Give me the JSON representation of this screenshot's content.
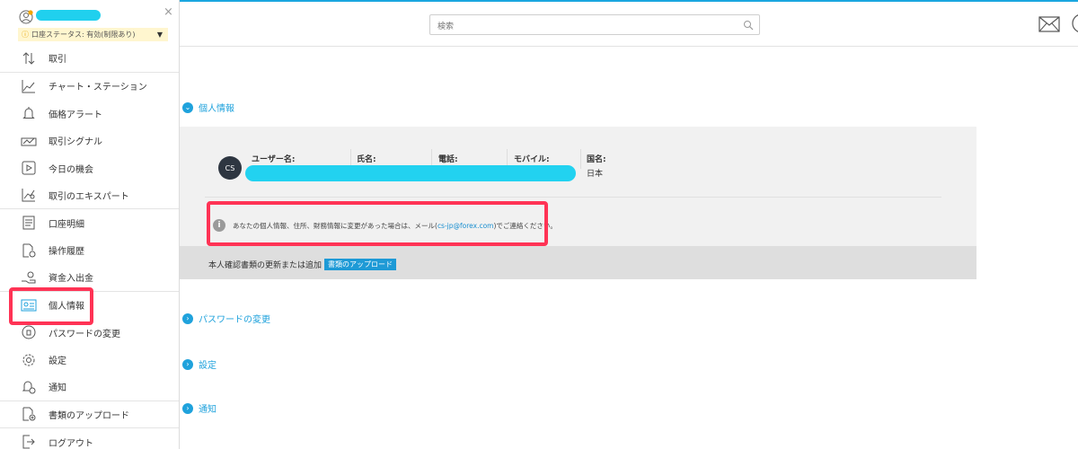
{
  "header": {
    "search_placeholder": "検索",
    "icons": [
      "search-icon",
      "mail-icon"
    ]
  },
  "sidebar": {
    "close": "×",
    "status_label": "口座ステータス: 有効(制限あり)",
    "items": [
      {
        "label": "取引",
        "icon": "arrows-updown-icon"
      },
      {
        "label": "チャート・ステーション",
        "icon": "line-chart-icon"
      },
      {
        "label": "価格アラート",
        "icon": "bell-icon"
      },
      {
        "label": "取引シグナル",
        "icon": "signal-icon"
      },
      {
        "label": "今日の機会",
        "icon": "play-icon"
      },
      {
        "label": "取引のエキスパート",
        "icon": "expert-icon"
      },
      {
        "label": "口座明細",
        "icon": "statement-icon"
      },
      {
        "label": "操作履歴",
        "icon": "history-icon"
      },
      {
        "label": "資金入出金",
        "icon": "funds-icon"
      },
      {
        "label": "個人情報",
        "icon": "id-card-icon"
      },
      {
        "label": "パスワードの変更",
        "icon": "password-icon"
      },
      {
        "label": "設定",
        "icon": "gear-icon"
      },
      {
        "label": "通知",
        "icon": "notification-icon"
      },
      {
        "label": "書類のアップロード",
        "icon": "document-upload-icon"
      },
      {
        "label": "ログアウト",
        "icon": "logout-icon"
      }
    ]
  },
  "main": {
    "sections": {
      "personal": "個人情報",
      "password": "パスワードの変更",
      "settings": "設定",
      "notifications": "通知"
    },
    "profile": {
      "avatar_initials": "CS",
      "username_label": "ユーザー名:",
      "name_label": "氏名:",
      "phone_label": "電話:",
      "mobile_label": "モバイル:",
      "country_label": "国名:",
      "country_value": "日本"
    },
    "notice": {
      "text_before": "あなたの個人情報、住所、財務情報に変更があった場合は、メール(",
      "email": "cs-jp@forex.com",
      "text_after": ")でご連絡ください。"
    },
    "update_docs_text": "本人確認書類の更新または追加",
    "upload_button": "書類のアップロード"
  }
}
